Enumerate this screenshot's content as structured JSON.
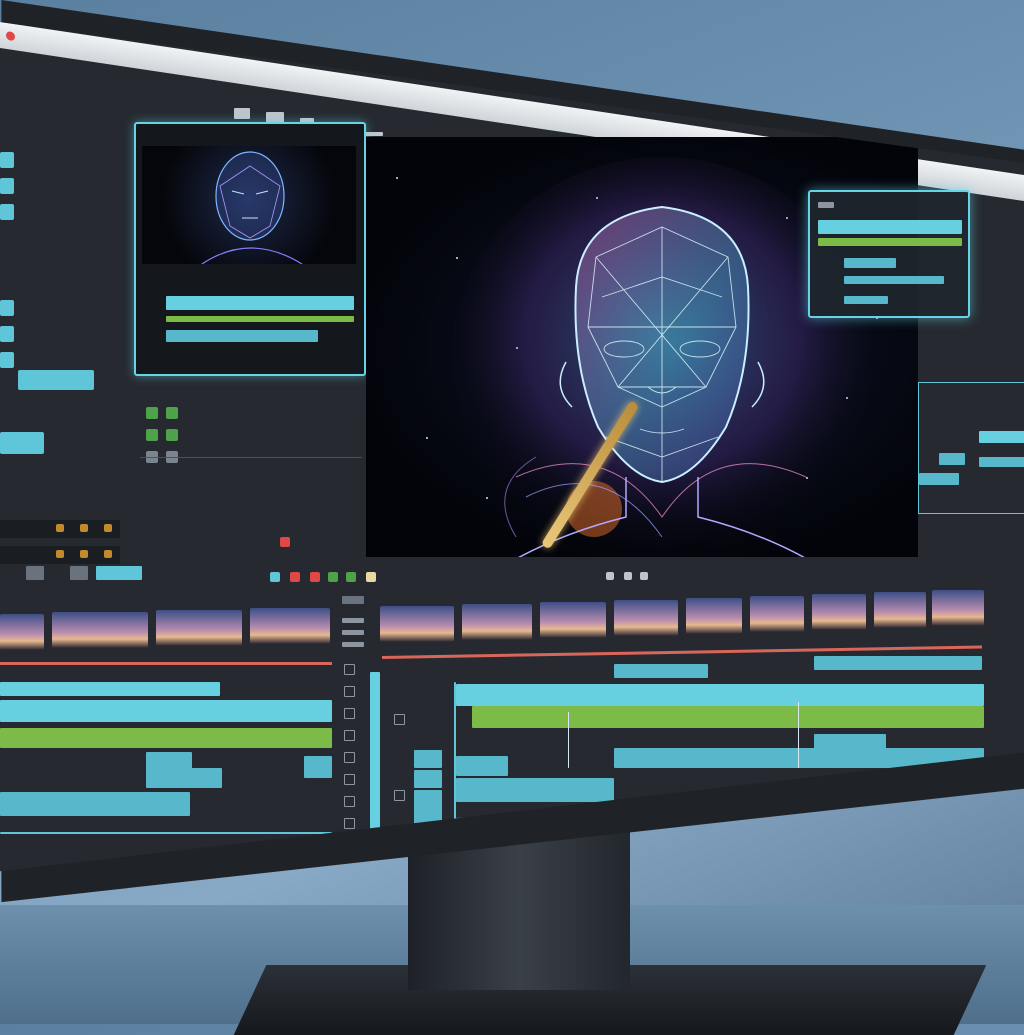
{
  "window": {
    "title": "",
    "menubar_label": "",
    "topbar_right_label": "",
    "rec_color": "#e04848"
  },
  "left_toolbox": {
    "section_label": ""
  },
  "preview_panel": {
    "label_primary": "",
    "label_secondary": "",
    "accent": "#66d4e6"
  },
  "info_panel": {
    "effect_label": "",
    "record_button_color": "#e04848"
  },
  "transport": {
    "timecode": ""
  },
  "colors": {
    "accent_cyan": "#66cfe0",
    "accent_green": "#7dbb48",
    "marker_red": "#d9665a",
    "bezel": "#1f2328",
    "panel_bg": "#262a30"
  },
  "icons": [
    "record-indicator-icon",
    "playhead-handle-icon",
    "grid-toggle-icon",
    "play-icon",
    "stop-icon"
  ]
}
